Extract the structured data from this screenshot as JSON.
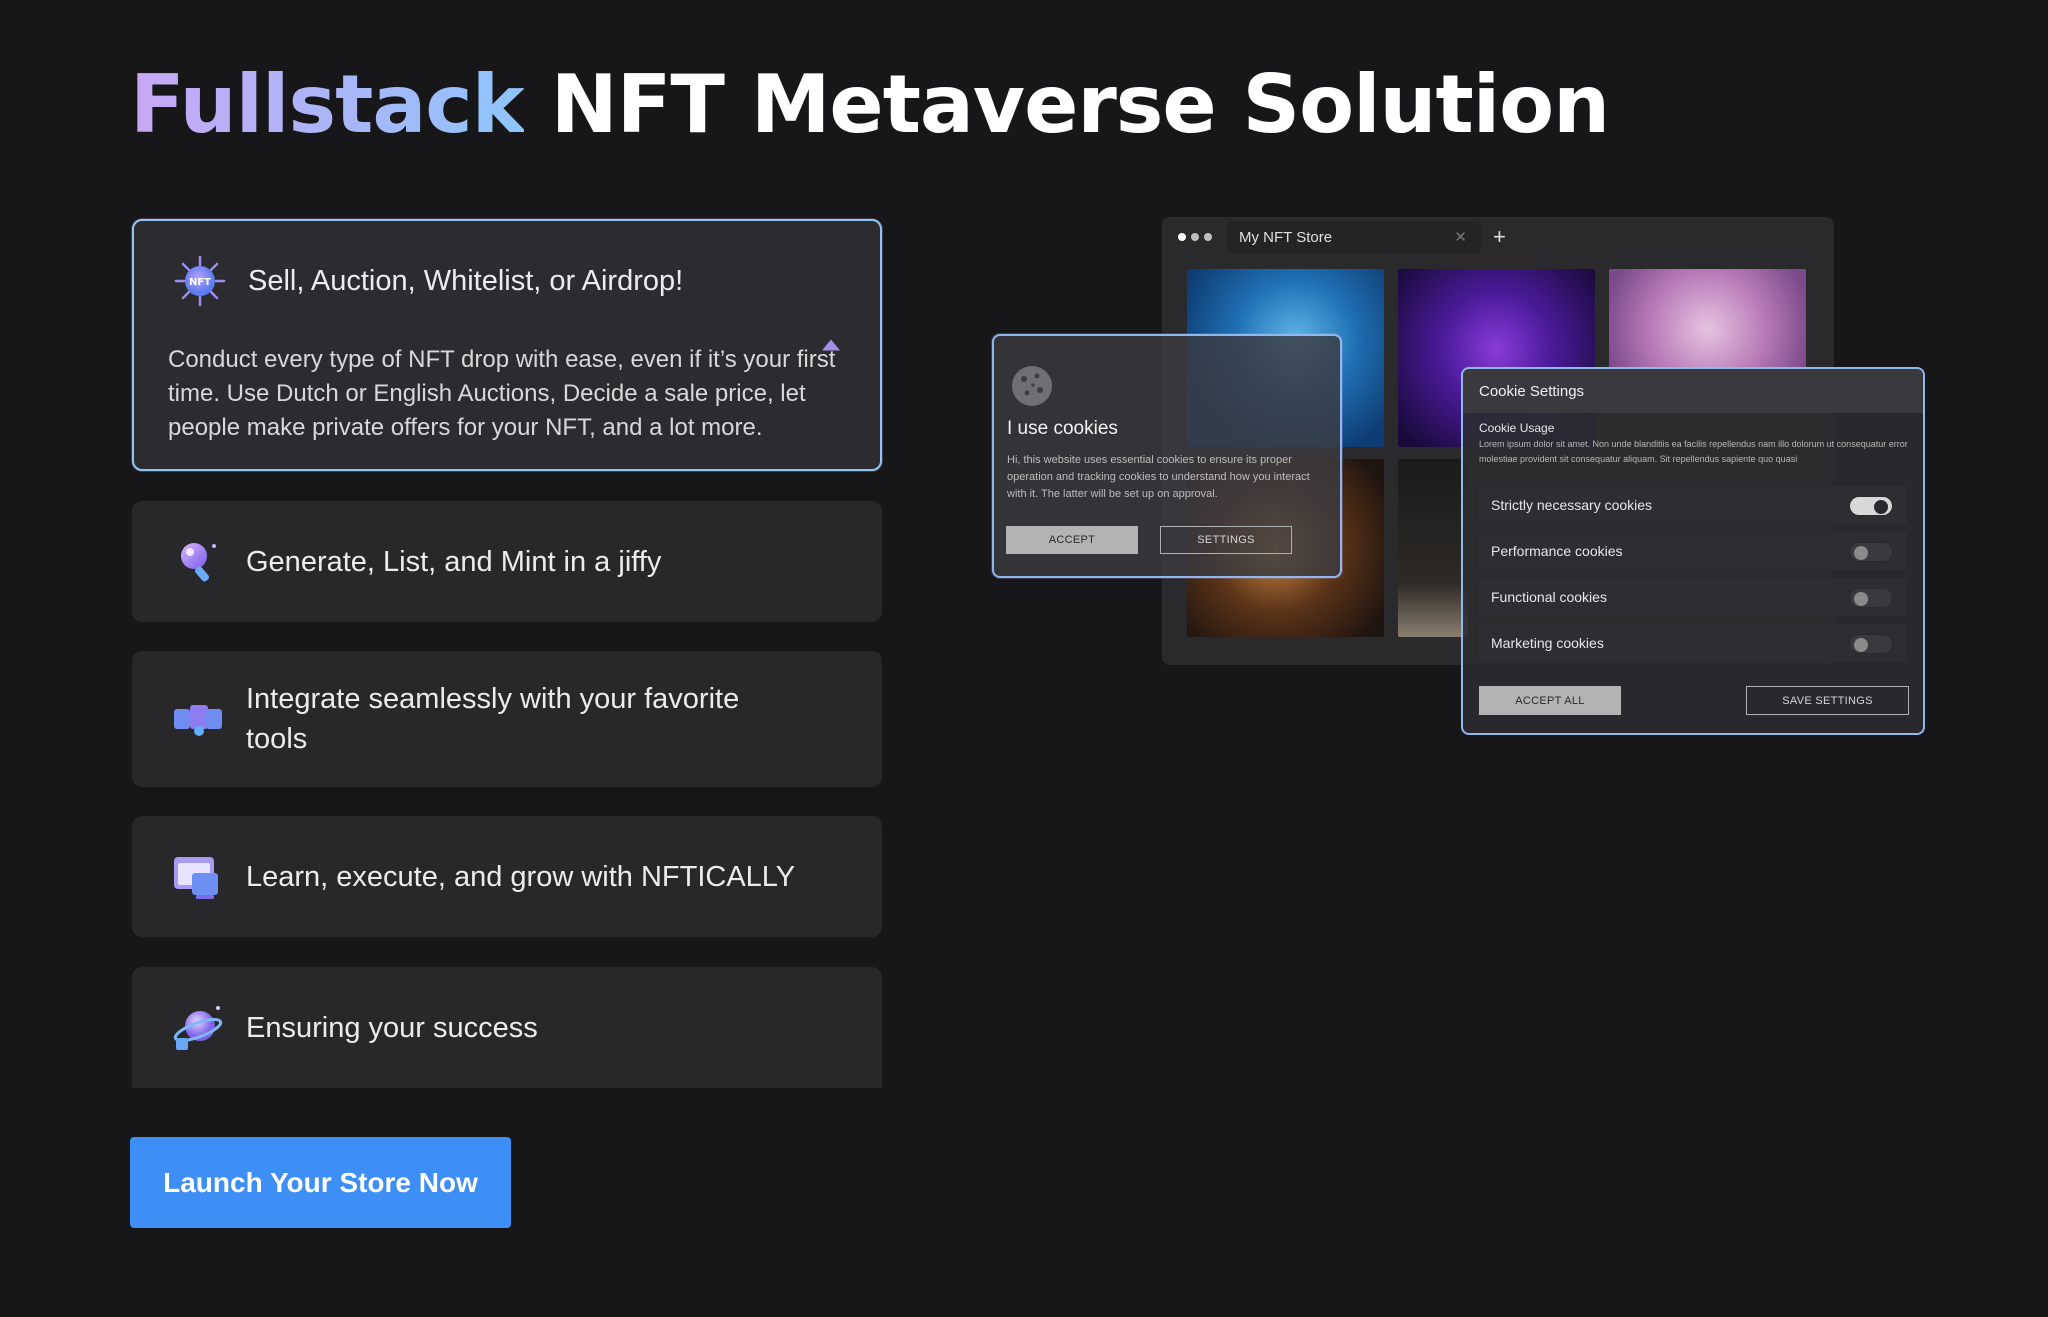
{
  "hero": {
    "title_highlight": "Fullstack",
    "title_rest": "NFT Metaverse Solution"
  },
  "features": [
    {
      "label": "Sell, Auction, Whitelist, or Airdrop!",
      "icon": "nft-badge-icon",
      "expanded": true,
      "description": "Conduct every type of NFT drop with ease, even if it’s your first time. Use Dutch or English Auctions, Decide a sale price, let people make private offers for your NFT, and a lot more."
    },
    {
      "label": "Generate, List, and Mint in a jiffy",
      "icon": "rocket-icon",
      "expanded": false
    },
    {
      "label": "Integrate seamlessly with your favorite tools",
      "icon": "integrations-icon",
      "expanded": false
    },
    {
      "label": "Learn, execute, and grow with NFTICALLY",
      "icon": "learning-screen-icon",
      "expanded": false
    },
    {
      "label": "Ensuring your success",
      "icon": "planet-icon",
      "expanded": false
    }
  ],
  "cta": {
    "label": "Launch Your Store Now"
  },
  "mockup": {
    "tab_title": "My NFT Store",
    "cookie_banner": {
      "title": "I use cookies",
      "text": "Hi, this website uses essential cookies to ensure its proper operation and tracking cookies to understand how you interact with it. The latter will be set up on approval.",
      "accept": "ACCEPT",
      "settings": "SETTINGS"
    },
    "cookie_settings": {
      "title": "Cookie Settings",
      "usage_title": "Cookie Usage",
      "usage_text": "Lorem ipsum dolor sit amet. Non unde blanditiis ea facilis repellendus nam illo dolorum ut consequatur error molestiae provident sit consequatur aliquam. Sit repellendus sapiente quo quasi",
      "rows": [
        {
          "label": "Strictly necessary cookies",
          "enabled": true
        },
        {
          "label": "Performance cookies",
          "enabled": false
        },
        {
          "label": "Functional cookies",
          "enabled": false
        },
        {
          "label": "Marketing cookies",
          "enabled": false
        }
      ],
      "accept_all": "ACCEPT ALL",
      "save": "SAVE SETTINGS"
    }
  },
  "colors": {
    "background": "#17171a",
    "panel": "#28282b",
    "accent_blue": "#3d8ff5",
    "border_highlight": "#8fc6ef",
    "gradient_start": "#c8a8f5",
    "gradient_end": "#8ec5fb"
  }
}
